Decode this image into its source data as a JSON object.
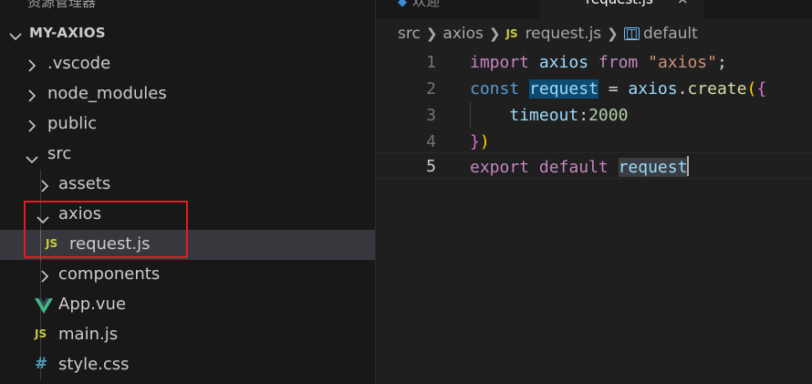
{
  "sidebar": {
    "top_clipped_text": "资源管理器",
    "root_label": "MY-AXIOS",
    "items": [
      {
        "label": ".vscode",
        "type": "folder",
        "expanded": false
      },
      {
        "label": "node_modules",
        "type": "folder",
        "expanded": false
      },
      {
        "label": "public",
        "type": "folder",
        "expanded": false
      },
      {
        "label": "src",
        "type": "folder",
        "expanded": true
      },
      {
        "label": "assets",
        "type": "folder",
        "expanded": false
      },
      {
        "label": "axios",
        "type": "folder",
        "expanded": true
      },
      {
        "label": "request.js",
        "type": "file",
        "icon": "JS",
        "selected": true
      },
      {
        "label": "components",
        "type": "folder",
        "expanded": false
      },
      {
        "label": "App.vue",
        "type": "file",
        "icon": "vue-icon"
      },
      {
        "label": "main.js",
        "type": "file",
        "icon": "JS"
      },
      {
        "label": "style.css",
        "type": "file",
        "icon": "#"
      }
    ]
  },
  "editor": {
    "tabs": {
      "inactive_label": "欢迎",
      "active_label": "request.js",
      "close_glyph": "×"
    },
    "breadcrumb": {
      "parts": [
        "src",
        "axios"
      ],
      "file_icon": "JS",
      "file": "request.js",
      "symbol": "default"
    },
    "line_numbers": [
      "1",
      "2",
      "3",
      "4",
      "5"
    ],
    "code": {
      "l1": {
        "kw": "import",
        "name": "axios",
        "from": "from",
        "str": "\"axios\"",
        "end": ";"
      },
      "l2": {
        "kw": "const",
        "name": "request",
        "eq": " = ",
        "obj": "axios",
        "dot": ".",
        "fn": "create",
        "paren": "(",
        "brace": "{"
      },
      "l3": {
        "key": "timeout",
        "colon": ":",
        "num": "2000"
      },
      "l4": {
        "brace": "}",
        "paren": ")"
      },
      "l5": {
        "kw1": "export",
        "kw2": "default",
        "name": "request"
      }
    }
  },
  "colors": {
    "selection_red_box": "#e51c23",
    "keyword_purple": "#c586c0",
    "keyword_blue": "#569cd6",
    "variable": "#9cdcfe",
    "string": "#ce9178",
    "number": "#b5cea8",
    "js_icon": "#cbcb41",
    "vue_icon": "#41b883",
    "css_icon": "#519aba"
  }
}
